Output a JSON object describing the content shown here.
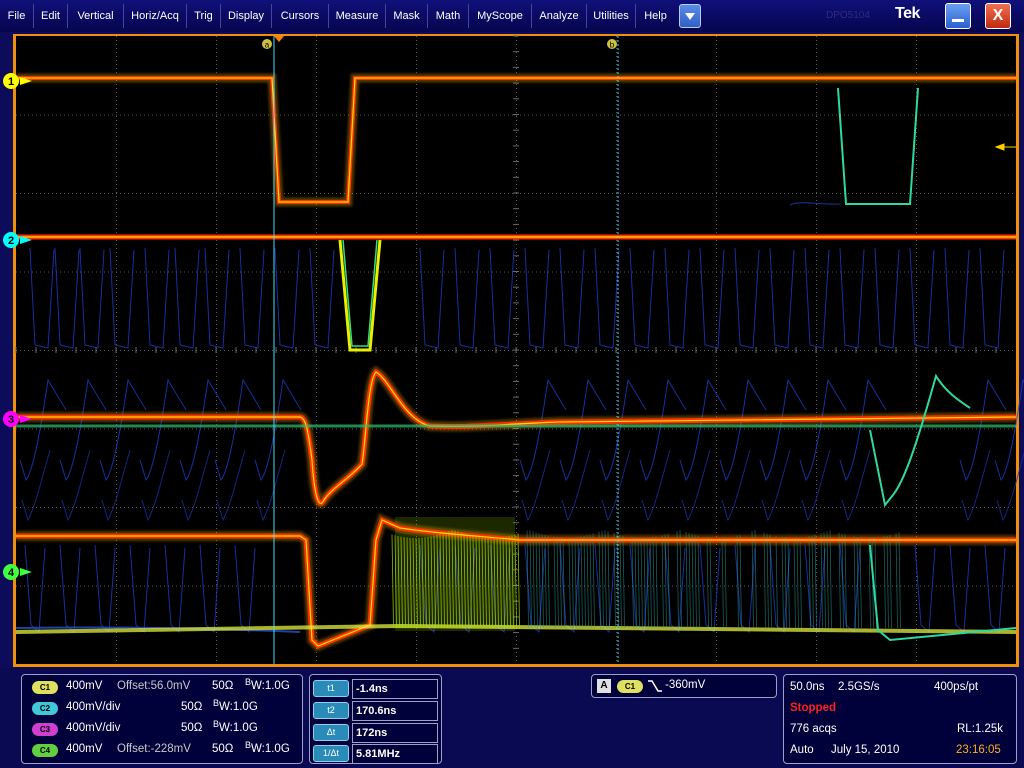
{
  "menu": {
    "items": [
      "File",
      "Edit",
      "Vertical",
      "Horiz/Acq",
      "Trig",
      "Display",
      "Cursors",
      "Measure",
      "Mask",
      "Math",
      "MyScope",
      "Analyze",
      "Utilities",
      "Help"
    ],
    "brand": "Tek",
    "faint_label": "DPO5104",
    "close_glyph": "X"
  },
  "graticule": {
    "cursor_a_label": "a",
    "cursor_b_label": "b"
  },
  "channels": [
    {
      "badge": "1",
      "color": "#ffff00"
    },
    {
      "badge": "2",
      "color": "#00ffff"
    },
    {
      "badge": "3",
      "color": "#ff00ff"
    },
    {
      "badge": "4",
      "color": "#40ff40"
    }
  ],
  "channel_settings": [
    {
      "badge": "C1",
      "color": "#e0e060",
      "scale": "400mV",
      "offset": "Offset:56.0mV",
      "impedance": "50Ω",
      "bandwidth": "W:1.0G",
      "bw_prefix": "B"
    },
    {
      "badge": "C2",
      "color": "#40c8d8",
      "scale": "400mV/div",
      "offset": "",
      "impedance": "50Ω",
      "bandwidth": "W:1.0G",
      "bw_prefix": "B"
    },
    {
      "badge": "C3",
      "color": "#d040d0",
      "scale": "400mV/div",
      "offset": "",
      "impedance": "50Ω",
      "bandwidth": "W:1.0G",
      "bw_prefix": "B"
    },
    {
      "badge": "C4",
      "color": "#60d040",
      "scale": "400mV",
      "offset": "Offset:-228mV",
      "impedance": "50Ω",
      "bandwidth": "W:1.0G",
      "bw_prefix": "B"
    }
  ],
  "cursors": [
    {
      "label": "t1",
      "value": "-1.4ns"
    },
    {
      "label": "t2",
      "value": "170.6ns"
    },
    {
      "label": "Δt",
      "value": "172ns"
    },
    {
      "label": "1/Δt",
      "value": "5.81MHz"
    }
  ],
  "trigger": {
    "mode": "A",
    "source": "C1",
    "level": "-360mV"
  },
  "acquisition": {
    "timebase": "50.0ns",
    "sample_rate": "2.5GS/s",
    "resolution": "400ps/pt",
    "state": "Stopped",
    "acqs": "776 acqs",
    "record_length": "RL:1.25k",
    "trigger_mode": "Auto",
    "date": "July 15, 2010",
    "time": "23:16:05"
  }
}
